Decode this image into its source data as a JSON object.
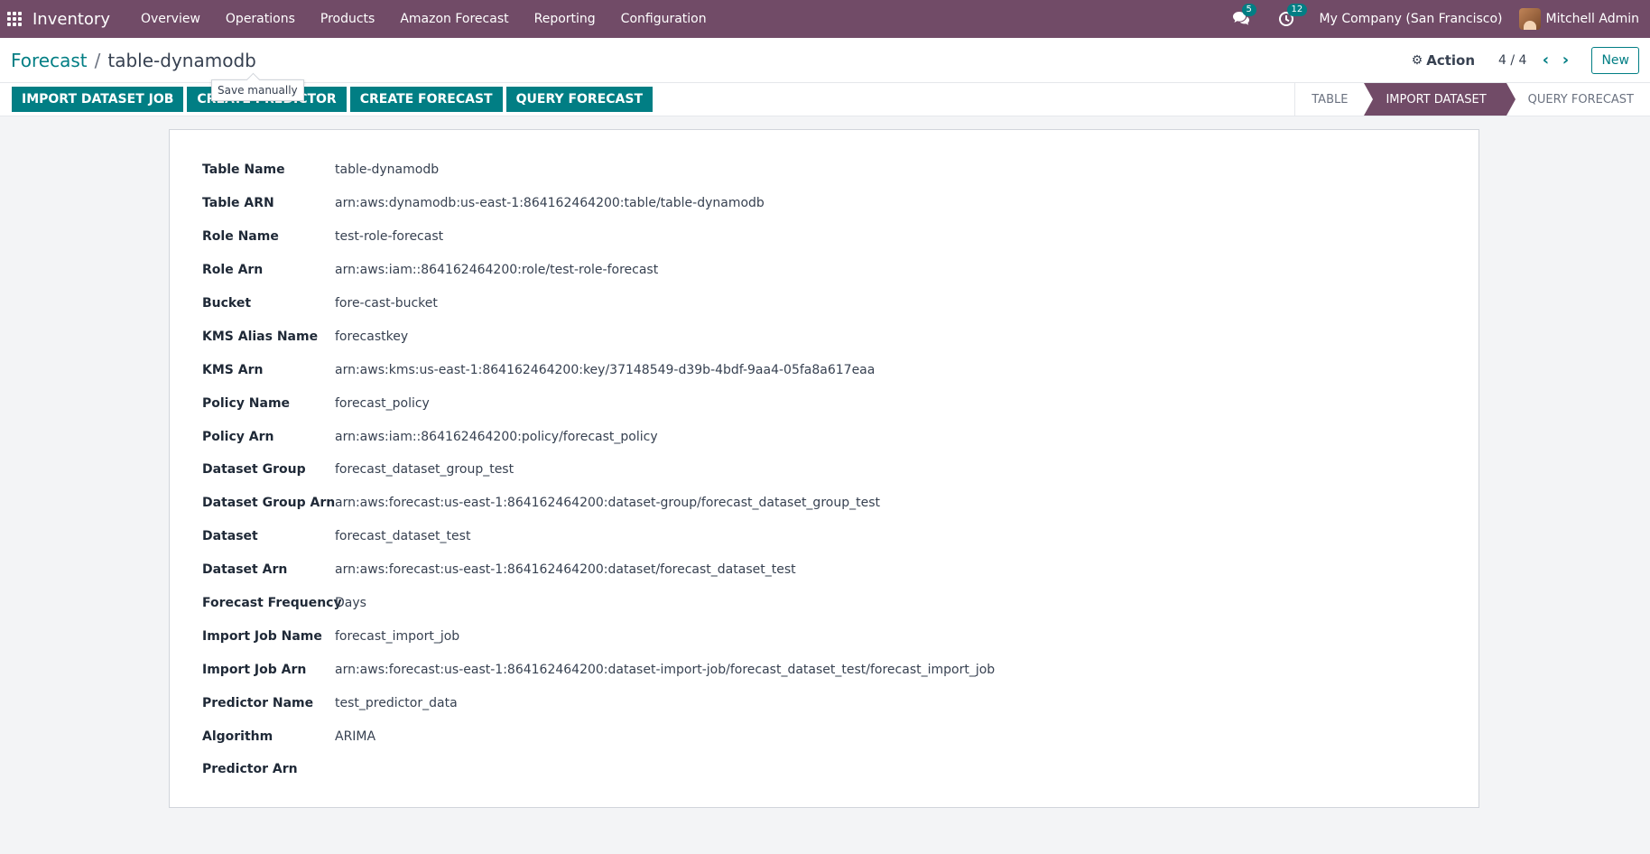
{
  "navbar": {
    "app_name": "Inventory",
    "menu": [
      "Overview",
      "Operations",
      "Products",
      "Amazon Forecast",
      "Reporting",
      "Configuration"
    ],
    "messages_count": "5",
    "activities_count": "12",
    "company": "My Company (San Francisco)",
    "user": "Mitchell Admin"
  },
  "control_panel": {
    "breadcrumb_parent": "Forecast",
    "breadcrumb_separator": "/",
    "breadcrumb_current": "table-dynamodb",
    "action_label": "Action",
    "pager": "4 / 4",
    "new_label": "New"
  },
  "tooltip": "Save manually",
  "header_buttons": [
    "IMPORT DATASET JOB",
    "CREATE PREDICTOR",
    "CREATE FORECAST",
    "QUERY FORECAST"
  ],
  "stages": [
    "TABLE",
    "IMPORT DATASET",
    "QUERY FORECAST"
  ],
  "active_stage": "IMPORT DATASET",
  "fields": [
    {
      "label": "Table Name",
      "value": "table-dynamodb"
    },
    {
      "label": "Table ARN",
      "value": "arn:aws:dynamodb:us-east-1:864162464200:table/table-dynamodb"
    },
    {
      "label": "Role Name",
      "value": "test-role-forecast"
    },
    {
      "label": "Role Arn",
      "value": "arn:aws:iam::864162464200:role/test-role-forecast"
    },
    {
      "label": "Bucket",
      "value": "fore-cast-bucket"
    },
    {
      "label": "KMS Alias Name",
      "value": "forecastkey"
    },
    {
      "label": "KMS Arn",
      "value": "arn:aws:kms:us-east-1:864162464200:key/37148549-d39b-4bdf-9aa4-05fa8a617eaa"
    },
    {
      "label": "Policy Name",
      "value": "forecast_policy"
    },
    {
      "label": "Policy Arn",
      "value": "arn:aws:iam::864162464200:policy/forecast_policy"
    },
    {
      "label": "Dataset Group",
      "value": "forecast_dataset_group_test"
    },
    {
      "label": "Dataset Group Arn",
      "value": "arn:aws:forecast:us-east-1:864162464200:dataset-group/forecast_dataset_group_test"
    },
    {
      "label": "Dataset",
      "value": "forecast_dataset_test"
    },
    {
      "label": "Dataset Arn",
      "value": "arn:aws:forecast:us-east-1:864162464200:dataset/forecast_dataset_test"
    },
    {
      "label": "Forecast Frequency",
      "value": "Days"
    },
    {
      "label": "Import Job Name",
      "value": "forecast_import_job"
    },
    {
      "label": "Import Job Arn",
      "value": "arn:aws:forecast:us-east-1:864162464200:dataset-import-job/forecast_dataset_test/forecast_import_job"
    },
    {
      "label": "Predictor Name",
      "value": "test_predictor_data"
    },
    {
      "label": "Algorithm",
      "value": "ARIMA"
    },
    {
      "label": "Predictor Arn",
      "value": ""
    }
  ],
  "colors": {
    "navbar": "#714b67",
    "primary_button": "#017e84",
    "active_stage": "#714b67"
  }
}
